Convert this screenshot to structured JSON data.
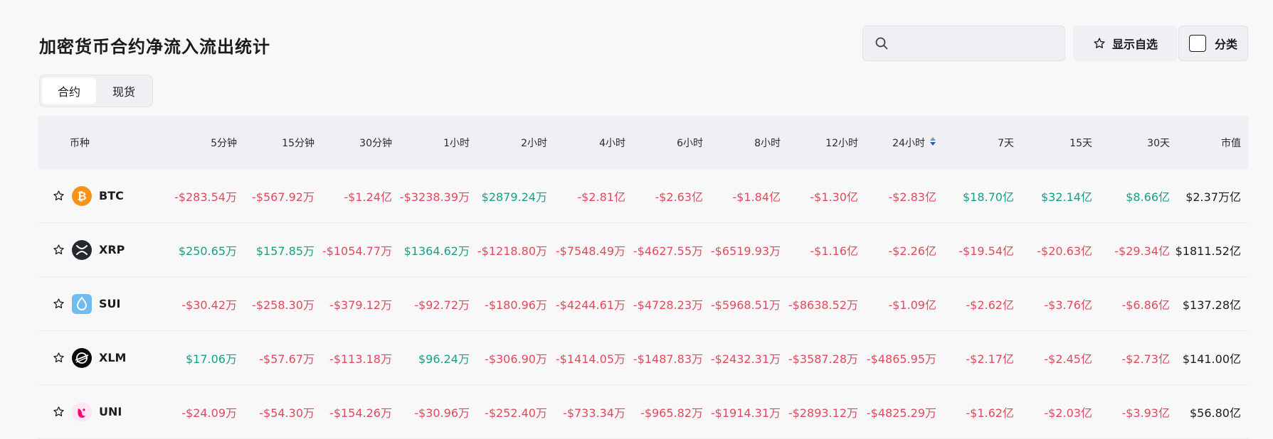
{
  "page": {
    "title": "加密货币合约净流入流出统计"
  },
  "toolbar": {
    "search_placeholder": "",
    "favorites_label": "显示自选",
    "category_label": "分类"
  },
  "tabs": [
    {
      "label": "合约",
      "active": true
    },
    {
      "label": "现货",
      "active": false
    }
  ],
  "table": {
    "columns": [
      "币种",
      "5分钟",
      "15分钟",
      "30分钟",
      "1小时",
      "2小时",
      "4小时",
      "6小时",
      "8小时",
      "12小时",
      "24小时",
      "7天",
      "15天",
      "30天",
      "市值"
    ],
    "sorted_column": "24小时",
    "rows": [
      {
        "symbol": "BTC",
        "icon": "bitcoin-icon",
        "logo_color": "#f7931a",
        "values": [
          "-$283.54万",
          "-$567.92万",
          "-$1.24亿",
          "-$3238.39万",
          "$2879.24万",
          "-$2.81亿",
          "-$2.63亿",
          "-$1.84亿",
          "-$1.30亿",
          "-$2.83亿",
          "$18.70亿",
          "$32.14亿",
          "$8.66亿"
        ],
        "market_cap": "$2.37万亿"
      },
      {
        "symbol": "XRP",
        "icon": "xrp-icon",
        "logo_color": "#23292f",
        "values": [
          "$250.65万",
          "$157.85万",
          "-$1054.77万",
          "$1364.62万",
          "-$1218.80万",
          "-$7548.49万",
          "-$4627.55万",
          "-$6519.93万",
          "-$1.16亿",
          "-$2.26亿",
          "-$19.54亿",
          "-$20.63亿",
          "-$29.34亿"
        ],
        "market_cap": "$1811.52亿"
      },
      {
        "symbol": "SUI",
        "icon": "sui-icon",
        "logo_color": "#6fbcf0",
        "values": [
          "-$30.42万",
          "-$258.30万",
          "-$379.12万",
          "-$92.72万",
          "-$180.96万",
          "-$4244.61万",
          "-$4728.23万",
          "-$5968.51万",
          "-$8638.52万",
          "-$1.09亿",
          "-$2.62亿",
          "-$3.76亿",
          "-$6.86亿"
        ],
        "market_cap": "$137.28亿"
      },
      {
        "symbol": "XLM",
        "icon": "stellar-icon",
        "logo_color": "#0b0b0b",
        "values": [
          "$17.06万",
          "-$57.67万",
          "-$113.18万",
          "$96.24万",
          "-$306.90万",
          "-$1414.05万",
          "-$1487.83万",
          "-$2432.31万",
          "-$3587.28万",
          "-$4865.95万",
          "-$2.17亿",
          "-$2.45亿",
          "-$2.73亿"
        ],
        "market_cap": "$141.00亿"
      },
      {
        "symbol": "UNI",
        "icon": "uniswap-icon",
        "logo_color": "#ff007a",
        "values": [
          "-$24.09万",
          "-$54.30万",
          "-$154.26万",
          "-$30.96万",
          "-$252.40万",
          "-$733.34万",
          "-$965.82万",
          "-$1914.31万",
          "-$2893.12万",
          "-$4825.29万",
          "-$1.62亿",
          "-$2.03亿",
          "-$3.93亿"
        ],
        "market_cap": "$56.80亿"
      }
    ]
  },
  "colors": {
    "negative": "#e04a5c",
    "positive": "#16a084"
  }
}
